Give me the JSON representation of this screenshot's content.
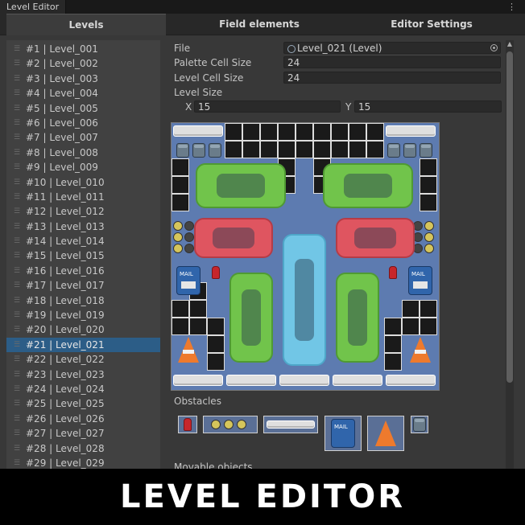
{
  "window": {
    "title": "Level Editor",
    "menu_glyph": "⋮"
  },
  "tabs": [
    {
      "label": "Levels",
      "active": true
    },
    {
      "label": "Field elements",
      "active": false
    },
    {
      "label": "Editor Settings",
      "active": false
    }
  ],
  "levels": [
    "#1 | Level_001",
    "#2 | Level_002",
    "#3 | Level_003",
    "#4 | Level_004",
    "#5 | Level_005",
    "#6 | Level_006",
    "#7 | Level_007",
    "#8 | Level_008",
    "#9 | Level_009",
    "#10 | Level_010",
    "#11 | Level_011",
    "#12 | Level_012",
    "#13 | Level_013",
    "#14 | Level_014",
    "#15 | Level_015",
    "#16 | Level_016",
    "#17 | Level_017",
    "#18 | Level_018",
    "#19 | Level_019",
    "#20 | Level_020",
    "#21 | Level_021",
    "#22 | Level_022",
    "#23 | Level_023",
    "#24 | Level_024",
    "#25 | Level_025",
    "#26 | Level_026",
    "#27 | Level_027",
    "#28 | Level_028",
    "#29 | Level_029"
  ],
  "selected_level": "#21 | Level_021",
  "inspector": {
    "file_label": "File",
    "file_value": "Level_021 (Level)",
    "palette_cell_size_label": "Palette Cell Size",
    "palette_cell_size_value": "24",
    "level_cell_size_label": "Level Cell Size",
    "level_cell_size_value": "24",
    "level_size_label": "Level Size",
    "x_label": "X",
    "x_value": "15",
    "y_label": "Y",
    "y_value": "15"
  },
  "obstacles_label": "Obstacles",
  "movable_label": "Movable objects",
  "mailbox_text": "MAIL",
  "banner_text": "LEVEL EDITOR",
  "colors": {
    "selection": "#2c5d87",
    "grid_blue": "#5d7bb0",
    "car_green": "#71c44b",
    "car_red": "#df5560",
    "car_blue": "#71c6e6",
    "mailbox": "#3065ab",
    "cone": "#ee7a2d"
  }
}
